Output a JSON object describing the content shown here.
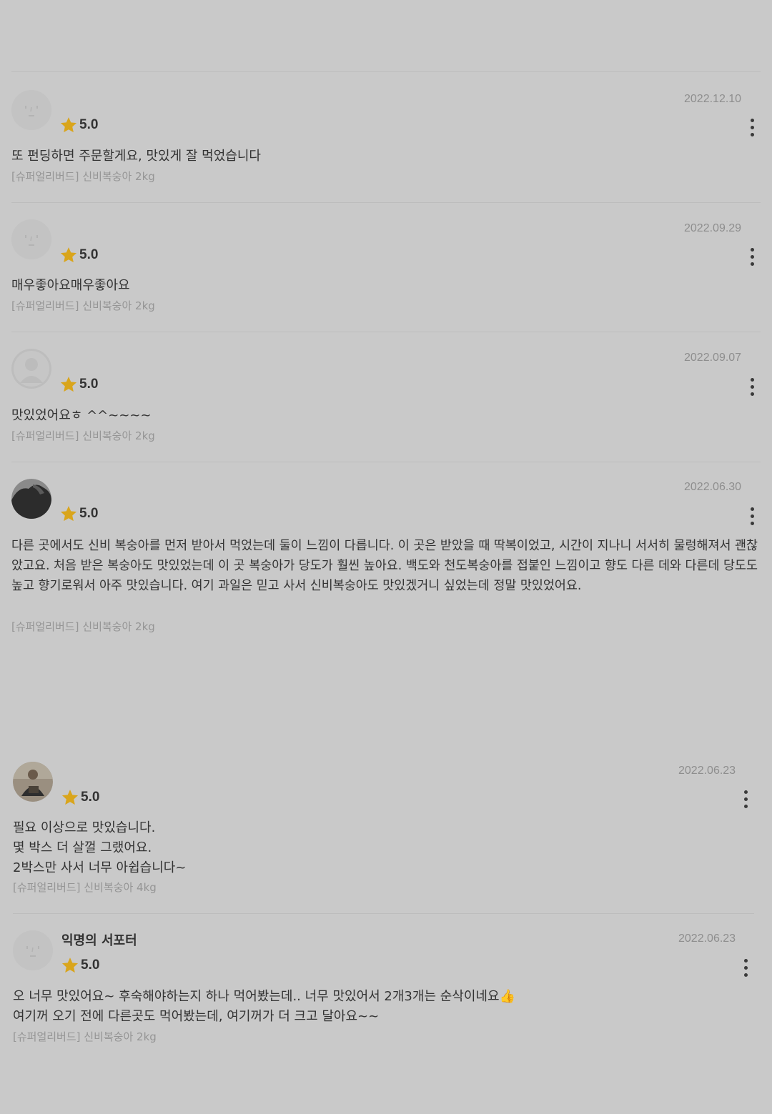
{
  "reviews": [
    {
      "date": "2022.12.10",
      "rating": "5.0",
      "text": "또 펀딩하면 주문할게요, 맛있게 잘 먹었습니다",
      "option": "[슈퍼얼리버드] 신비복숭아 2kg",
      "avatar_icon": "face-placeholder-icon"
    },
    {
      "date": "2022.09.29",
      "rating": "5.0",
      "text": "매우좋아요매우좋아요",
      "option": "[슈퍼얼리버드] 신비복숭아 2kg",
      "avatar_icon": "face-placeholder-icon"
    },
    {
      "date": "2022.09.07",
      "rating": "5.0",
      "text": "맛있었어요ㅎ ^^~~~~",
      "option": "[슈퍼얼리버드] 신비복숭아 2kg",
      "avatar_icon": "person-silhouette-icon"
    },
    {
      "date": "2022.06.30",
      "rating": "5.0",
      "text": "다른 곳에서도 신비 복숭아를 먼저 받아서 먹었는데 둘이 느낌이 다릅니다. 이 곳은 받았을 때 딱복이었고, 시간이 지나니 서서히 물렁해져서 괜찮았고요. 처음 받은 복숭아도 맛있었는데 이 곳 복숭아가 당도가 훨씬 높아요. 백도와 천도복숭아를 접붙인 느낌이고 향도 다른 데와 다른데 당도도 높고 향기로워서 아주 맛있습니다. 여기 과일은 믿고 사서 신비복숭아도 맛있겠거니 싶었는데 정말 맛있었어요.",
      "option": "[슈퍼얼리버드] 신비복숭아 2kg",
      "avatar_icon": "photo-avatar-dark"
    },
    {
      "date": "2022.06.23",
      "rating": "5.0",
      "text": "필요 이상으로 맛있습니다.\n몇 박스 더 살껄 그랬어요.\n2박스만 사서 너무 아쉽습니다~",
      "option": "[슈퍼얼리버드] 신비복숭아 4kg",
      "avatar_icon": "photo-avatar-person"
    },
    {
      "nickname": "익명의 서포터",
      "date": "2022.06.23",
      "rating": "5.0",
      "text": "오 너무 맛있어요~ 후숙해야하는지 하나 먹어봤는데.. 너무 맛있어서 2개3개는 순삭이네요👍\n여기꺼 오기 전에 다른곳도 먹어봤는데, 여기꺼가 더 크고 달아요~~",
      "option": "[슈퍼얼리버드] 신비복숭아 2kg",
      "avatar_icon": "face-placeholder-icon"
    }
  ],
  "colors": {
    "background": "#c9c9c9",
    "star": "#d9a51c",
    "date": "#8e8e8e",
    "option": "#959595"
  }
}
